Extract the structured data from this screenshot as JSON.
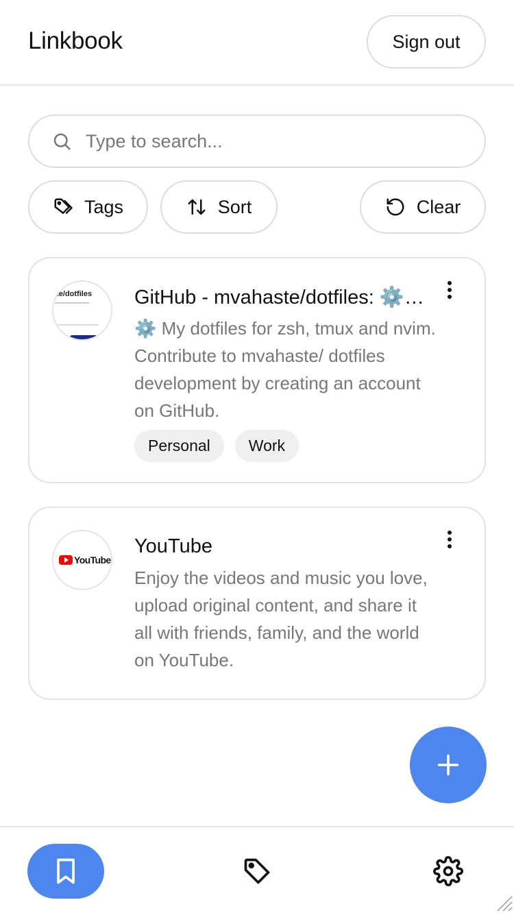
{
  "header": {
    "title": "Linkbook",
    "signout_label": "Sign out"
  },
  "search": {
    "placeholder": "Type to search..."
  },
  "filters": {
    "tags_label": "Tags",
    "sort_label": "Sort",
    "clear_label": "Clear"
  },
  "links": [
    {
      "title": "GitHub - mvahaste/dotfiles: ⚙️ My dotfiles for zsh, tmux and nvim",
      "description": "⚙️ My dotfiles for zsh, tmux and nvim. Contribute to mvahaste/ dotfiles development by creating an account on GitHub.",
      "thumb_text": "ste/dotfiles",
      "tags": [
        "Personal",
        "Work"
      ]
    },
    {
      "title": "YouTube",
      "description": "Enjoy the videos and music you love, upload original content, and share it all with friends, family, and the world on YouTube.",
      "thumb_text": "YouTube",
      "tags": []
    }
  ],
  "colors": {
    "accent": "#4c86ee",
    "youtube_red": "#ff0000",
    "border": "#dcdcdc",
    "muted_text": "#777777",
    "chip_bg": "#efefef"
  },
  "icons": {
    "search": "search-icon",
    "tags": "tag-icon",
    "sort": "sort-arrows-icon",
    "clear": "rotate-ccw-icon",
    "menu": "more-vertical-icon",
    "add": "plus-icon",
    "nav_bookmarks": "bookmark-icon",
    "nav_tags": "tag-icon",
    "nav_settings": "gear-icon"
  }
}
